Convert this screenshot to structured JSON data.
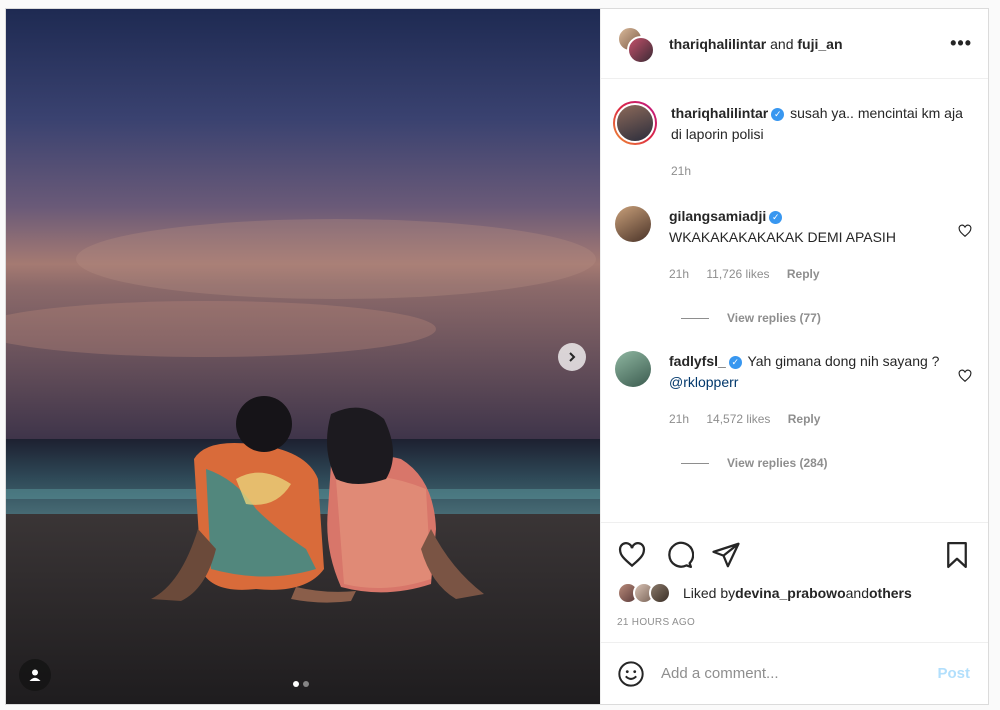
{
  "header": {
    "user1": "thariqhalilintar",
    "joiner": " and ",
    "user2": "fuji_an",
    "more": "•••"
  },
  "caption": {
    "username": "thariqhalilintar",
    "text": "susah ya.. mencintai km aja di laporin polisi",
    "time": "21h"
  },
  "comments": [
    {
      "username": "gilangsamiadji",
      "text": "WKAKAKAKAKAKAK DEMI APASIH",
      "time": "21h",
      "likes": "11,726 likes",
      "reply": "Reply",
      "view_replies": "View replies (77)"
    },
    {
      "username": "fadlyfsl_",
      "text": "Yah gimana dong nih sayang ? ",
      "mention": "@rklopperr",
      "time": "21h",
      "likes": "14,572 likes",
      "reply": "Reply",
      "view_replies": "View replies (284)"
    }
  ],
  "liked": {
    "prefix": "Liked by ",
    "user": "devina_prabowo",
    "joiner": " and ",
    "others": "others"
  },
  "timestamp": "21 HOURS AGO",
  "add_comment": {
    "placeholder": "Add a comment...",
    "post": "Post"
  },
  "carousel": {
    "slide_count": 2,
    "active_index": 0
  },
  "colors": {
    "accent": "#3897f0",
    "post_disabled": "#b2dffc",
    "muted": "#8e8e8e"
  }
}
